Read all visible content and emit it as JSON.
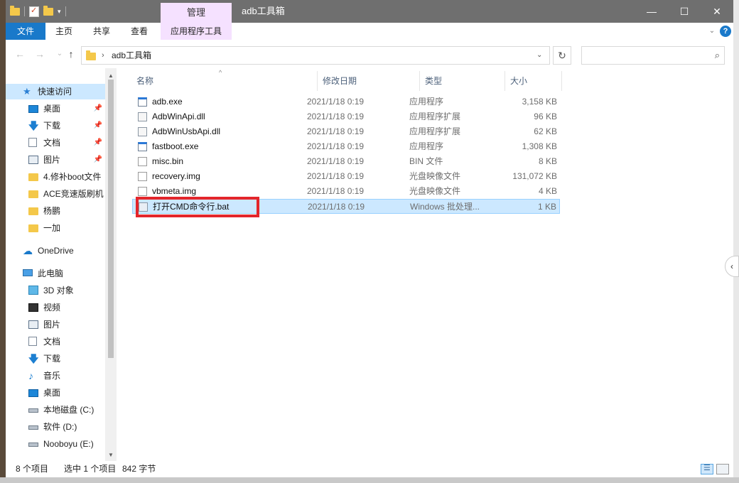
{
  "window": {
    "title": "adb工具箱",
    "context_tab": "管理",
    "controls": {
      "minimize": "—",
      "maximize": "☐",
      "close": "✕"
    }
  },
  "ribbon": {
    "file": "文件",
    "home": "主页",
    "share": "共享",
    "view": "查看",
    "app_tools": "应用程序工具",
    "help": "?"
  },
  "nav": {
    "back": "←",
    "forward": "→",
    "up": "↑",
    "address": "adb工具箱",
    "address_sep": "›",
    "dropdown": "⌄",
    "refresh": "↻",
    "search_placeholder": "",
    "search_icon": "⌕"
  },
  "sidebar": {
    "items": [
      {
        "label": "快速访问",
        "icon": "star-icon",
        "selected": true
      },
      {
        "label": "桌面",
        "icon": "desktop-icon",
        "pin": "📌"
      },
      {
        "label": "下载",
        "icon": "download-icon",
        "pin": "📌"
      },
      {
        "label": "文档",
        "icon": "document-icon",
        "pin": "📌"
      },
      {
        "label": "图片",
        "icon": "picture-icon",
        "pin": "📌"
      },
      {
        "label": "4.修补boot文件",
        "icon": "folder-icon"
      },
      {
        "label": "ACE竞速版刷机",
        "icon": "folder-icon"
      },
      {
        "label": "杨鹏",
        "icon": "folder-icon"
      },
      {
        "label": "一加",
        "icon": "folder-icon"
      },
      {
        "label": "OneDrive",
        "icon": "cloud-icon"
      },
      {
        "label": "此电脑",
        "icon": "computer-icon"
      },
      {
        "label": "3D 对象",
        "icon": "3d-objects-icon"
      },
      {
        "label": "视频",
        "icon": "video-icon"
      },
      {
        "label": "图片",
        "icon": "picture-icon"
      },
      {
        "label": "文档",
        "icon": "document-icon"
      },
      {
        "label": "下载",
        "icon": "download-icon"
      },
      {
        "label": "音乐",
        "icon": "music-icon"
      },
      {
        "label": "桌面",
        "icon": "desktop-icon"
      },
      {
        "label": "本地磁盘 (C:)",
        "icon": "drive-icon"
      },
      {
        "label": "软件 (D:)",
        "icon": "drive-icon"
      },
      {
        "label": "Nooboyu (E:)",
        "icon": "drive-icon"
      }
    ]
  },
  "columns": {
    "name": "名称",
    "date": "修改日期",
    "type": "类型",
    "size": "大小"
  },
  "files": [
    {
      "name": "adb.exe",
      "date": "2021/1/18 0:19",
      "type": "应用程序",
      "size": "3,158 KB"
    },
    {
      "name": "AdbWinApi.dll",
      "date": "2021/1/18 0:19",
      "type": "应用程序扩展",
      "size": "96 KB"
    },
    {
      "name": "AdbWinUsbApi.dll",
      "date": "2021/1/18 0:19",
      "type": "应用程序扩展",
      "size": "62 KB"
    },
    {
      "name": "fastboot.exe",
      "date": "2021/1/18 0:19",
      "type": "应用程序",
      "size": "1,308 KB"
    },
    {
      "name": "misc.bin",
      "date": "2021/1/18 0:19",
      "type": "BIN 文件",
      "size": "8 KB"
    },
    {
      "name": "recovery.img",
      "date": "2021/1/18 0:19",
      "type": "光盘映像文件",
      "size": "131,072 KB"
    },
    {
      "name": "vbmeta.img",
      "date": "2021/1/18 0:19",
      "type": "光盘映像文件",
      "size": "4 KB"
    },
    {
      "name": "打开CMD命令行.bat",
      "date": "2021/1/18 0:19",
      "type": "Windows 批处理...",
      "size": "1 KB"
    }
  ],
  "status": {
    "count": "8 个项目",
    "selected": "选中 1 个项目",
    "size": "842 字节"
  }
}
